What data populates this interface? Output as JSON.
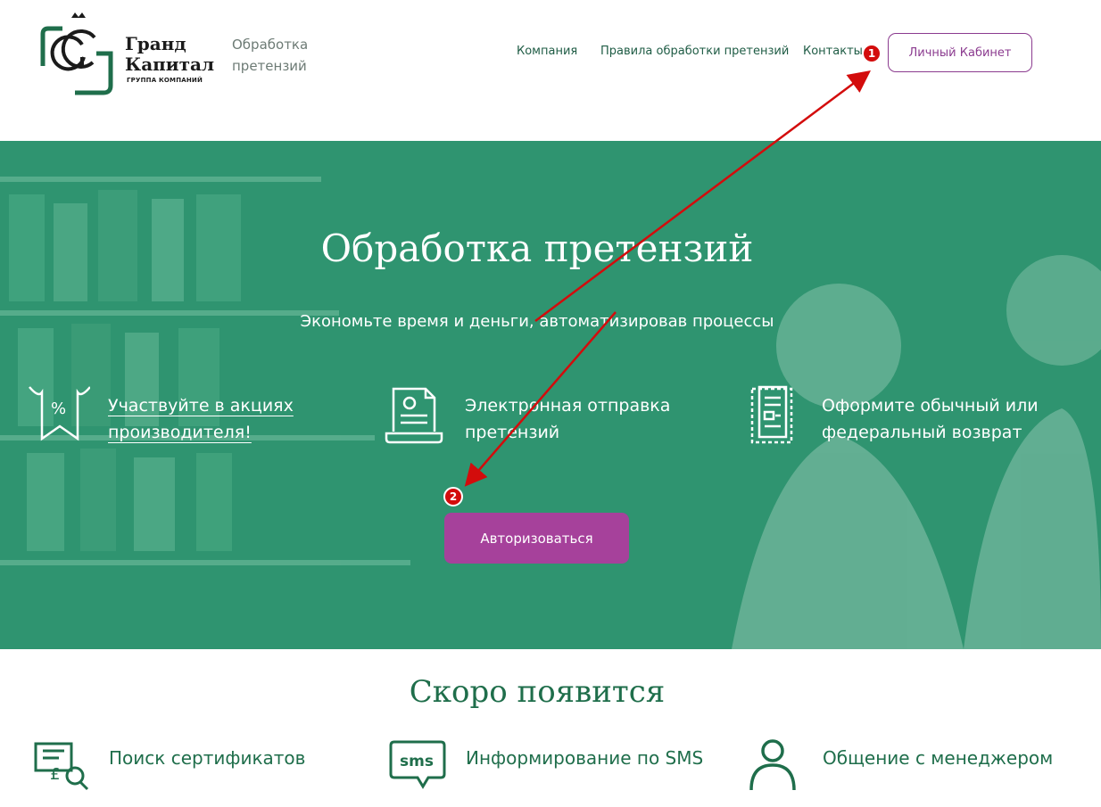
{
  "header": {
    "logo_name_line1": "Гранд",
    "logo_name_line2": "Капитал",
    "logo_sub": "ГРУППА КОМПАНИЙ",
    "site_sub": "Обработка претензий",
    "nav": {
      "company": "Компания",
      "rules": "Правила обработки претензий",
      "contacts": "Контакты"
    },
    "cabinet_label": "Личный Кабинет"
  },
  "hero": {
    "title": "Обработка претензий",
    "tagline": "Экономьте время и деньги, автоматизировав процессы",
    "features": [
      {
        "text": "Участвуйте в акциях производителя!",
        "icon": "discount-tag-icon"
      },
      {
        "text": "Электронная отправка претензий",
        "icon": "laptop-document-icon"
      },
      {
        "text": "Оформите обычный или федеральный возврат",
        "icon": "document-form-icon"
      }
    ],
    "auth_label": "Авторизоваться"
  },
  "annotations": {
    "badge1": "1",
    "badge2": "2",
    "color": "#d30c0c"
  },
  "soon": {
    "title": "Скоро появится",
    "items": [
      {
        "text": "Поиск сертификатов",
        "icon": "certificate-search-icon"
      },
      {
        "text": "Информирование по SMS",
        "icon": "sms-icon"
      },
      {
        "text": "Общение с менеджером",
        "icon": "user-icon"
      }
    ]
  },
  "colors": {
    "brand_green": "#1f6e4b",
    "hero_green": "#2f9470",
    "accent_purple": "#a6419b"
  }
}
